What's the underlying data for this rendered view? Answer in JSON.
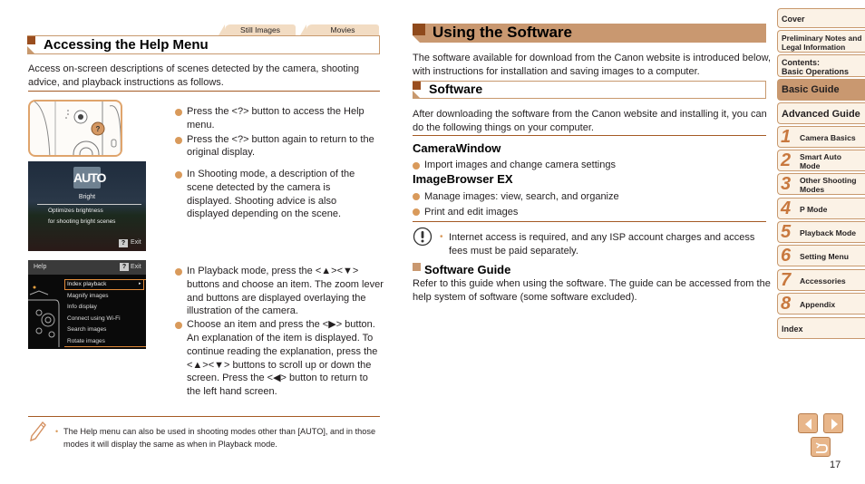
{
  "left": {
    "tabs": [
      "Still Images",
      "Movies"
    ],
    "title": "Accessing the Help Menu",
    "intro": "Access on-screen descriptions of scenes detected by the camera, shooting advice, and playback instructions as follows.",
    "step1": [
      "Press the <?> button to access the Help menu.",
      "Press the <?> button again to return to the original display."
    ],
    "step2": [
      "In Shooting mode, a description of the scene detected by the camera is displayed. Shooting advice is also displayed depending on the scene."
    ],
    "step3": [
      "In Playback mode, press the <▲><▼> buttons and choose an item. The zoom lever and buttons are displayed overlaying the illustration of the camera.",
      "Choose an item and press the <▶> button. An explanation of the item is displayed. To continue reading the explanation, press the <▲><▼> buttons to scroll up or down the screen. Press the <◀> button to return to the left hand screen."
    ],
    "shoot_screen": {
      "mode": "AUTO",
      "scene": "Bright",
      "desc1": "Optimizes brightness",
      "desc2": "for shooting bright scenes",
      "exit": "Exit",
      "help_key": "?"
    },
    "help_screen": {
      "title": "Help",
      "exit": "Exit",
      "help_key": "?",
      "items": [
        "Index playback",
        "Magnify images",
        "Info display",
        "Connect using Wi-Fi",
        "Search images",
        "Rotate images"
      ]
    },
    "note": "The Help menu can also be used in shooting modes other than [AUTO], and in those modes it will display the same as when in Playback mode."
  },
  "right": {
    "title": "Using the Software",
    "intro": "The software available for download from the Canon website is introduced below, with instructions for installation and saving images to a computer.",
    "software_title": "Software",
    "software_intro": "After downloading the software from the Canon website and installing it, you can do the following things on your computer.",
    "apps": [
      {
        "name": "CameraWindow",
        "features": [
          "Import images and change camera settings"
        ]
      },
      {
        "name": "ImageBrowser EX",
        "features": [
          "Manage images: view, search, and organize",
          "Print and edit images"
        ]
      }
    ],
    "caution": "Internet access is required, and any ISP account charges and access fees must be paid separately.",
    "guide_title": "Software Guide",
    "guide_text": "Refer to this guide when using the software. The guide can be accessed from the help system of software (some software excluded)."
  },
  "sidebar": {
    "top": [
      {
        "label": "Cover"
      },
      {
        "label1": "Preliminary Notes and",
        "label2": "Legal Information"
      },
      {
        "label1": "Contents:",
        "label2": "Basic Operations"
      },
      {
        "label": "Basic Guide",
        "active": true
      },
      {
        "label": "Advanced Guide"
      }
    ],
    "chapters": [
      {
        "num": "1",
        "label1": "Camera Basics"
      },
      {
        "num": "2",
        "label1": "Smart Auto",
        "label2": "Mode"
      },
      {
        "num": "3",
        "label1": "Other Shooting",
        "label2": "Modes"
      },
      {
        "num": "4",
        "label1": "P Mode"
      },
      {
        "num": "5",
        "label1": "Playback Mode"
      },
      {
        "num": "6",
        "label1": "Setting Menu"
      },
      {
        "num": "7",
        "label1": "Accessories"
      },
      {
        "num": "8",
        "label1": "Appendix"
      }
    ],
    "index": "Index"
  },
  "page_number": "17",
  "colors": {
    "accent": "#c99870",
    "accent_dark": "#9a4e1f",
    "bullet": "#d99a5b",
    "rule": "#a55a24"
  }
}
